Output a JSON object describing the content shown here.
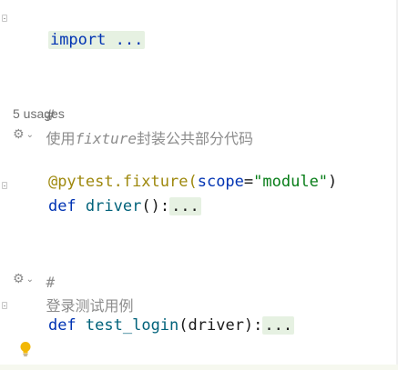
{
  "lines": {
    "import": {
      "keyword": "import",
      "collapsed": " ..."
    },
    "comment1": {
      "hash": "#",
      "text_a": "使用",
      "text_b": "fixture",
      "text_c": "封装公共部分代码"
    },
    "usages": "5 usages",
    "decorator": {
      "at": "@pytest.fixture(",
      "arg_name": "scope",
      "eq": "=",
      "arg_value": "\"module\"",
      "close": ")"
    },
    "def_driver": {
      "keyword": "def",
      "name": "driver",
      "parens": "():",
      "collapsed": "..."
    },
    "comment2": {
      "hash": "#",
      "text": "登录测试用例"
    },
    "def_test_login": {
      "keyword": "def",
      "name": "test_login",
      "params": "(driver):",
      "collapsed": "..."
    }
  },
  "icons": {
    "inlay_hint": "pytest-run-icon",
    "bulb": "lightbulb-icon"
  },
  "colors": {
    "keyword": "#0033b3",
    "function": "#00627a",
    "decorator": "#9e880d",
    "string": "#067d17",
    "comment": "#8c8c8c",
    "collapsed_bg": "#e6f1e2",
    "bulb": "#f2b705"
  }
}
